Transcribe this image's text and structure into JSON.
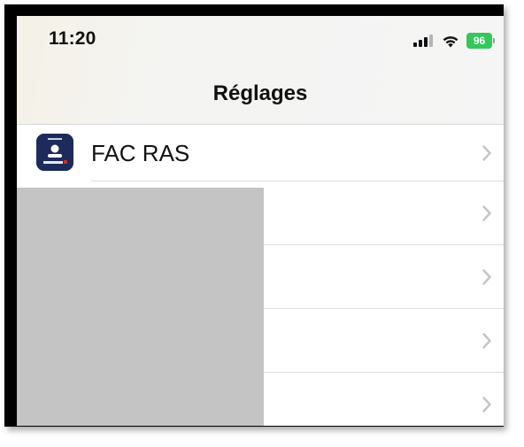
{
  "status_bar": {
    "time": "11:20",
    "battery_percent": "96",
    "signal_icon": "cellular-signal-icon",
    "wifi_icon": "wifi-icon",
    "battery_icon": "battery-charging-icon",
    "battery_color": "#34c759"
  },
  "nav": {
    "title": "Réglages"
  },
  "list": {
    "items": [
      {
        "label": "FAC RAS",
        "icon": "fac-ras-app-icon"
      },
      {
        "label": ""
      },
      {
        "label": ""
      },
      {
        "label": ""
      },
      {
        "label": ""
      }
    ]
  },
  "colors": {
    "chevron": "#c4c4c7",
    "app_icon_bg": "#1c2b5c",
    "redaction": "#c4c4c4"
  }
}
